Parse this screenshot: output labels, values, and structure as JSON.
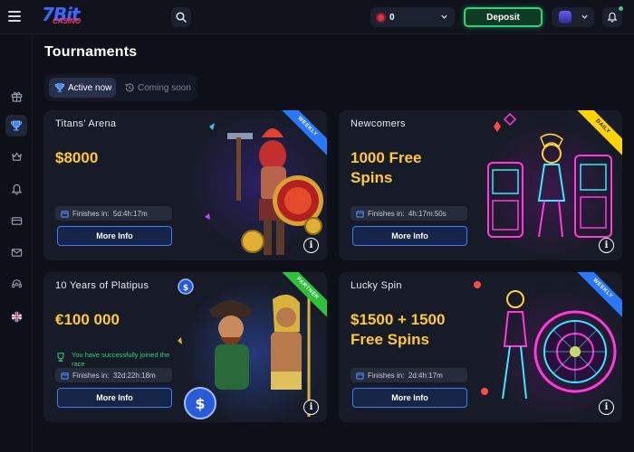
{
  "header": {
    "logo_main": "7Bit",
    "logo_sub": "CASINO",
    "balance": "0",
    "deposit_label": "Deposit",
    "notifications_count": "0"
  },
  "page": {
    "title": "Tournaments"
  },
  "tabs": [
    {
      "label": "Active now",
      "active": true
    },
    {
      "label": "Coming soon",
      "active": false
    }
  ],
  "sidebar_icons": [
    "gift-icon",
    "trophy-icon",
    "crown-icon",
    "bell-icon",
    "card-icon",
    "mail-icon",
    "support-icon",
    "language-flag-icon"
  ],
  "cards": [
    {
      "title": "Titans’ Arena",
      "prize_line1": "$8000",
      "prize_line2": "",
      "finish_label": "Finishes in:",
      "finish_time": "5d:4h:17m",
      "button": "More Info",
      "ribbon": "WEEKLY",
      "ribbon_color": "#2a78ff"
    },
    {
      "title": "Newcomers",
      "prize_line1": "1000 Free",
      "prize_line2": "Spins",
      "finish_label": "Finishes in:",
      "finish_time": "4h:17m:50s",
      "button": "More Info",
      "ribbon": "DAILY",
      "ribbon_color": "#ffd400"
    },
    {
      "title": "10 Years of Platipus",
      "prize_line1": "€100 000",
      "prize_line2": "",
      "joined_text": "You have successfully joined the race",
      "finish_label": "Finishes in:",
      "finish_time": "32d:22h:18m",
      "button": "More Info",
      "ribbon": "PARTNER",
      "ribbon_color": "#2ec23a"
    },
    {
      "title": "Lucky Spin",
      "prize_line1": "$1500 + 1500",
      "prize_line2": "Free Spins",
      "finish_label": "Finishes in:",
      "finish_time": "2d:4h:17m",
      "button": "More Info",
      "ribbon": "WEEKLY",
      "ribbon_color": "#2a78ff"
    }
  ],
  "colors": {
    "background": "#0d1019",
    "card": "#171b27",
    "prize": "#ffc931",
    "accent_blue": "#3d7bff",
    "deposit_green": "#2fd27a"
  }
}
